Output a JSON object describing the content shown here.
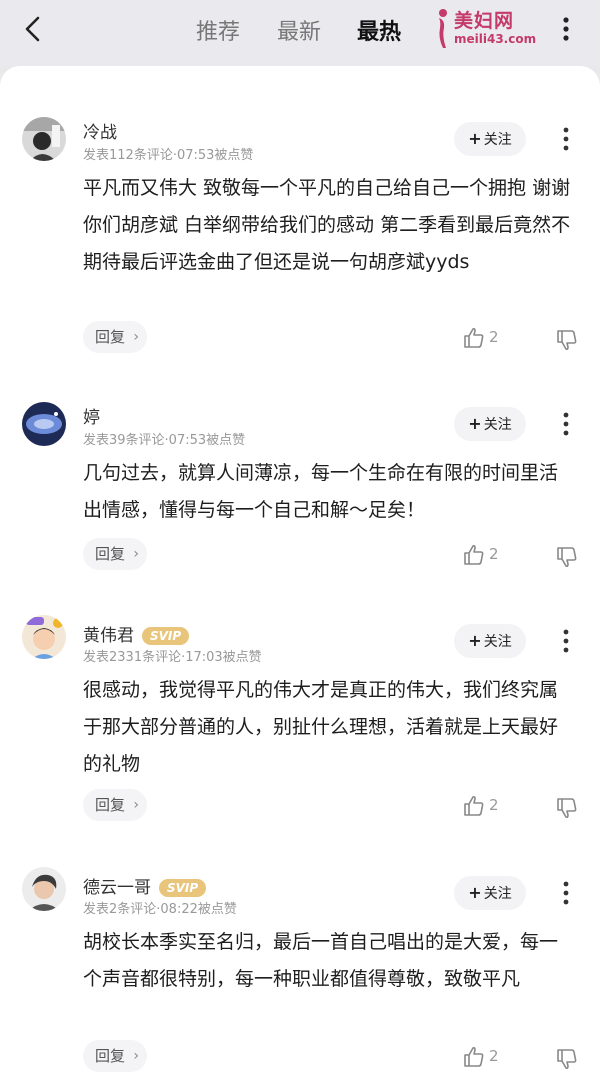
{
  "header": {
    "tabs": [
      {
        "label": "推荐",
        "active": false
      },
      {
        "label": "最新",
        "active": false
      },
      {
        "label": "最热",
        "active": true
      }
    ],
    "watermark": {
      "title": "美妇网",
      "url": "meili43.com"
    },
    "icons": {
      "back": "chevron-left-icon",
      "more": "more-vertical-icon"
    }
  },
  "labels": {
    "follow": "关注",
    "reply": "回复"
  },
  "comments": [
    {
      "user": "冷战",
      "svip": "",
      "meta": "发表112条评论·07:53被点赞",
      "text": "平凡而又伟大  致敬每一个平凡的自己给自己一个拥抱 谢谢你们胡彦斌 白举纲带给我们的感动 第二季看到最后竟然不期待最后评选金曲了但还是说一句胡彦斌yyds",
      "likes": "2"
    },
    {
      "user": "婷",
      "svip": "",
      "meta": "发表39条评论·07:53被点赞",
      "text": "几句过去，就算人间薄凉，每一个生命在有限的时间里活出情感，懂得与每一个自己和解～足矣！",
      "likes": "2"
    },
    {
      "user": "黄伟君",
      "svip": "SVIP",
      "meta": "发表2331条评论·17:03被点赞",
      "text": "很感动，我觉得平凡的伟大才是真正的伟大，我们终究属于那大部分普通的人，别扯什么理想，活着就是上天最好的礼物",
      "likes": "2"
    },
    {
      "user": "德云一哥",
      "svip": "SVIP",
      "meta": "发表2条评论·08:22被点赞",
      "text": "胡校长本季实至名归，最后一首自己唱出的是大爱，每一个声音都很特别，每一种职业都值得尊敬，致敬平凡",
      "likes": "2"
    }
  ],
  "colors": {
    "accent": "#c43a68",
    "svip": "#e8c57a"
  }
}
